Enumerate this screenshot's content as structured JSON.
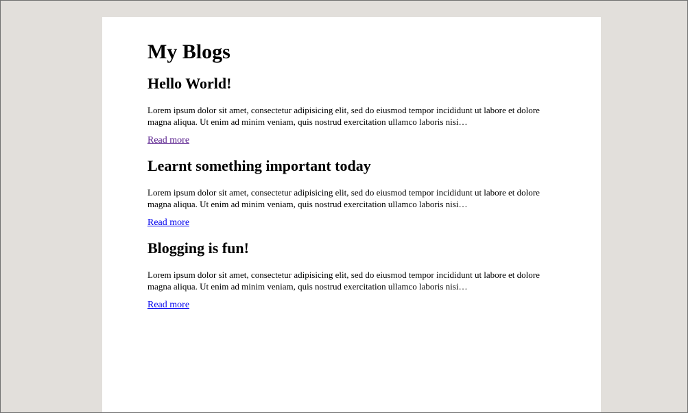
{
  "page": {
    "title": "My Blogs"
  },
  "posts": [
    {
      "title": "Hello World!",
      "excerpt": "Lorem ipsum dolor sit amet, consectetur adipisicing elit, sed do eiusmod tempor incididunt ut labore et dolore magna aliqua. Ut enim ad minim veniam, quis nostrud exercitation ullamco laboris nisi…",
      "link_label": "Read more",
      "link_color": "#551a8b"
    },
    {
      "title": "Learnt something important today",
      "excerpt": "Lorem ipsum dolor sit amet, consectetur adipisicing elit, sed do eiusmod tempor incididunt ut labore et dolore magna aliqua. Ut enim ad minim veniam, quis nostrud exercitation ullamco laboris nisi…",
      "link_label": "Read more",
      "link_color": "#0000ee"
    },
    {
      "title": "Blogging is fun!",
      "excerpt": "Lorem ipsum dolor sit amet, consectetur adipisicing elit, sed do eiusmod tempor incididunt ut labore et dolore magna aliqua. Ut enim ad minim veniam, quis nostrud exercitation ullamco laboris nisi…",
      "link_label": "Read more",
      "link_color": "#0000ee"
    }
  ],
  "colors": {
    "background": "#e2dfdb",
    "page": "#ffffff",
    "visited_link": "#551a8b",
    "link": "#0000ee"
  }
}
